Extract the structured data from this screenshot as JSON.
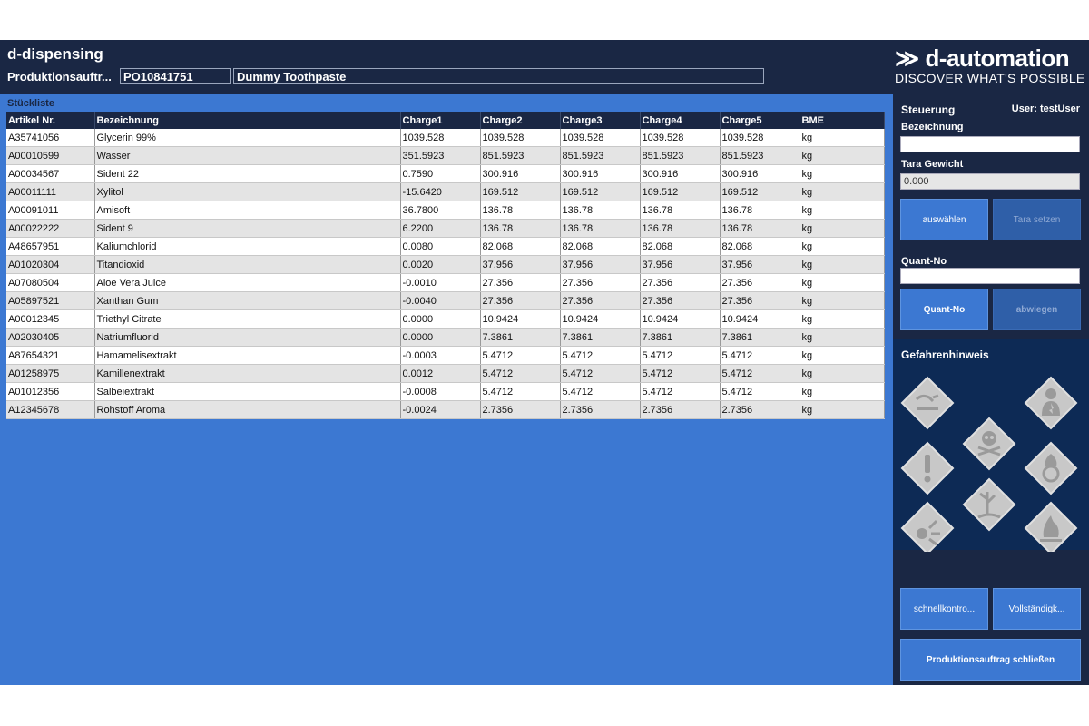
{
  "header": {
    "app_title": "d-dispensing",
    "po_label": "Produktionsauftr...",
    "po_number": "PO10841751",
    "product_name": "Dummy Toothpaste",
    "logo_main": "≫ d-automation",
    "logo_sub": "DISCOVER WHAT'S POSSIBLE"
  },
  "stueckliste": {
    "label": "Stückliste",
    "columns": [
      "Artikel Nr.",
      "Bezeichnung",
      "Charge1",
      "Charge2",
      "Charge3",
      "Charge4",
      "Charge5",
      "BME"
    ],
    "rows": [
      [
        "A35741056",
        "Glycerin 99%",
        "1039.528",
        "1039.528",
        "1039.528",
        "1039.528",
        "1039.528",
        "kg"
      ],
      [
        "A00010599",
        "Wasser",
        "351.5923",
        "851.5923",
        "851.5923",
        "851.5923",
        "851.5923",
        "kg"
      ],
      [
        "A00034567",
        "Sident 22",
        "0.7590",
        "300.916",
        "300.916",
        "300.916",
        "300.916",
        "kg"
      ],
      [
        "A00011111",
        "Xylitol",
        "-15.6420",
        "169.512",
        "169.512",
        "169.512",
        "169.512",
        "kg"
      ],
      [
        "A00091011",
        "Amisoft",
        "36.7800",
        "136.78",
        "136.78",
        "136.78",
        "136.78",
        "kg"
      ],
      [
        "A00022222",
        "Sident 9",
        "6.2200",
        "136.78",
        "136.78",
        "136.78",
        "136.78",
        "kg"
      ],
      [
        "A48657951",
        "Kaliumchlorid",
        "0.0080",
        "82.068",
        "82.068",
        "82.068",
        "82.068",
        "kg"
      ],
      [
        "A01020304",
        "Titandioxid",
        "0.0020",
        "37.956",
        "37.956",
        "37.956",
        "37.956",
        "kg"
      ],
      [
        "A07080504",
        "Aloe Vera Juice",
        "-0.0010",
        "27.356",
        "27.356",
        "27.356",
        "27.356",
        "kg"
      ],
      [
        "A05897521",
        "Xanthan Gum",
        "-0.0040",
        "27.356",
        "27.356",
        "27.356",
        "27.356",
        "kg"
      ],
      [
        "A00012345",
        "Triethyl Citrate",
        "0.0000",
        "10.9424",
        "10.9424",
        "10.9424",
        "10.9424",
        "kg"
      ],
      [
        "A02030405",
        "Natriumfluorid",
        "0.0000",
        "7.3861",
        "7.3861",
        "7.3861",
        "7.3861",
        "kg"
      ],
      [
        "A87654321",
        "Hamamelisextrakt",
        "-0.0003",
        "5.4712",
        "5.4712",
        "5.4712",
        "5.4712",
        "kg"
      ],
      [
        "A01258975",
        "Kamillenextrakt",
        "0.0012",
        "5.4712",
        "5.4712",
        "5.4712",
        "5.4712",
        "kg"
      ],
      [
        "A01012356",
        "Salbeiextrakt",
        "-0.0008",
        "5.4712",
        "5.4712",
        "5.4712",
        "5.4712",
        "kg"
      ],
      [
        "A12345678",
        "Rohstoff Aroma",
        "-0.0024",
        "2.7356",
        "2.7356",
        "2.7356",
        "2.7356",
        "kg"
      ]
    ]
  },
  "steuerung": {
    "title": "Steuerung",
    "user": "User: testUser",
    "bezeichnung_label": "Bezeichnung",
    "bezeichnung_value": "",
    "tara_label": "Tara Gewicht",
    "tara_value": "0.000",
    "btn_auswaehlen": "auswählen",
    "btn_tara_setzen": "Tara setzen",
    "quant_label": "Quant-No",
    "quant_value": "",
    "btn_quant_no": "Quant-No",
    "btn_abwiegen": "abwiegen"
  },
  "gefahrenhinweis": {
    "title": "Gefahrenhinweis",
    "pictograms": [
      "corrosive-icon",
      "health-hazard-icon",
      "toxic-skull-icon",
      "exclamation-icon",
      "oxidizer-icon",
      "environment-icon",
      "explosive-icon",
      "flammable-icon"
    ]
  },
  "actions": {
    "btn_schnellkontrolle": "schnellkontro...",
    "btn_vollstaendig": "Vollständigk...",
    "btn_schliessen": "Produktionsauftrag schließen"
  },
  "colors": {
    "dark_navy": "#1a2744",
    "blue": "#3c78d2",
    "hazard_panel": "#0d2a55",
    "pictogram_gray": "#c8c8c8"
  }
}
